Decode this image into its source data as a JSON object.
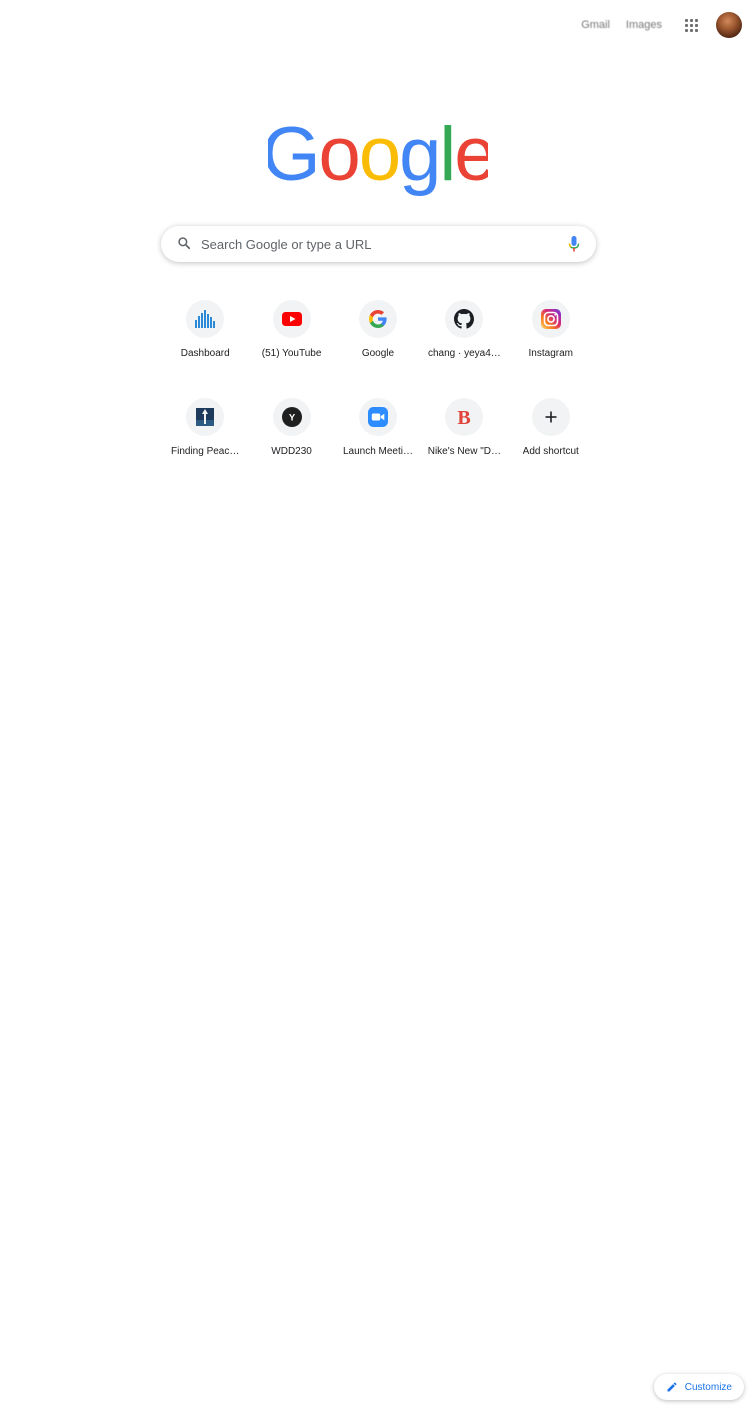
{
  "header": {
    "gmail_label": "Gmail",
    "images_label": "Images",
    "apps_icon": "apps-grid-icon",
    "avatar_icon": "account-avatar"
  },
  "logo": {
    "text": "Google",
    "letters": [
      {
        "char": "G",
        "color": "#4285F4"
      },
      {
        "char": "o",
        "color": "#EA4335"
      },
      {
        "char": "o",
        "color": "#FBBC05"
      },
      {
        "char": "g",
        "color": "#4285F4"
      },
      {
        "char": "l",
        "color": "#34A853"
      },
      {
        "char": "e",
        "color": "#EA4335"
      }
    ]
  },
  "search": {
    "placeholder": "Search Google or type a URL",
    "value": "",
    "search_icon": "search-icon",
    "mic_icon": "microphone-icon"
  },
  "shortcuts": [
    {
      "label": "Dashboard",
      "icon": "dashboard-bars-icon"
    },
    {
      "label": "(51) YouTube",
      "icon": "youtube-icon"
    },
    {
      "label": "Google",
      "icon": "google-g-icon"
    },
    {
      "label": "chang · yeya4…",
      "icon": "github-icon"
    },
    {
      "label": "Instagram",
      "icon": "instagram-icon"
    },
    {
      "label": "Finding Peac…",
      "icon": "finding-peace-icon"
    },
    {
      "label": "WDD230",
      "icon": "y-circle-icon"
    },
    {
      "label": "Launch Meeti…",
      "icon": "zoom-icon"
    },
    {
      "label": "Nike's New \"D…",
      "icon": "b-letter-icon"
    },
    {
      "label": "Add shortcut",
      "icon": "plus-icon"
    }
  ],
  "customize": {
    "label": "Customize",
    "icon": "pencil-icon"
  },
  "colors": {
    "accent": "#1a73e8",
    "tile_bg": "#f1f3f4",
    "youtube_red": "#FF0000",
    "dashboard_blue": "#2b8ad8",
    "zoom_blue": "#2D8CFF",
    "b_red": "#e0443a"
  }
}
